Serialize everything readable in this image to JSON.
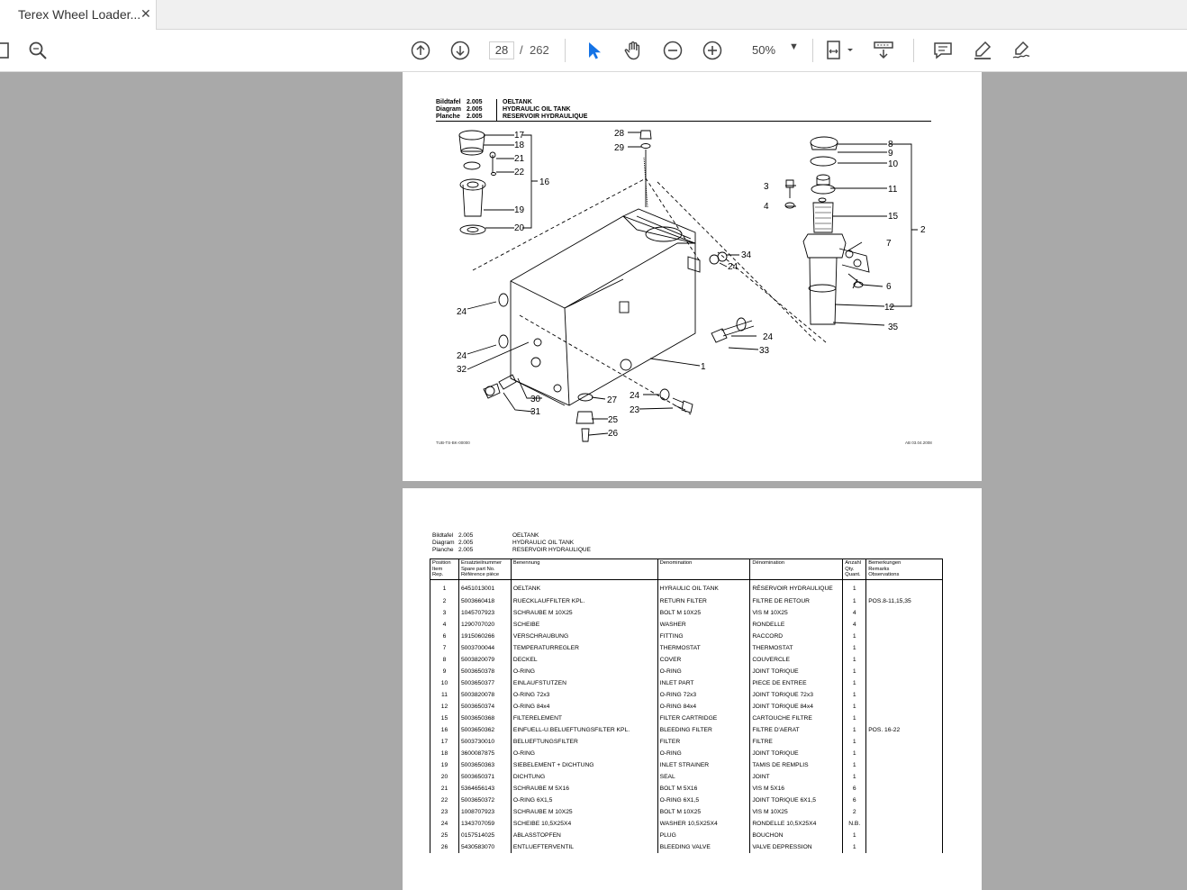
{
  "tab": {
    "title": "Terex Wheel Loader...",
    "close": "✕"
  },
  "toolbar": {
    "page_current": "28",
    "page_separator": "/",
    "page_total": "262",
    "zoom": "50%",
    "icons": [
      "sidebar-icon",
      "search-icon",
      "page-up-icon",
      "page-down-icon",
      "select-cursor-icon",
      "hand-icon",
      "zoom-out-icon",
      "zoom-in-icon",
      "fit-page-icon",
      "scroll-mode-icon",
      "comment-icon",
      "highlight-icon",
      "sign-icon"
    ]
  },
  "page1": {
    "header": {
      "rows": [
        {
          "label": "Bildtafel",
          "num": "2.005",
          "text": "OELTANK"
        },
        {
          "label": "Diagram",
          "num": "2.005",
          "text": "HYDRAULIC OIL TANK"
        },
        {
          "label": "Planche",
          "num": "2.005",
          "text": "RESERVOIR HYDRAULIQUE"
        }
      ]
    },
    "footer_left": "TUB-TS-BK-00000",
    "footer_right": "AB 03.04.2008",
    "callouts": [
      "17",
      "18",
      "21",
      "22",
      "16",
      "19",
      "20",
      "28",
      "29",
      "8",
      "9",
      "10",
      "3",
      "11",
      "4",
      "15",
      "2",
      "7",
      "34",
      "24",
      "6",
      "12",
      "35",
      "24",
      "24",
      "32",
      "1",
      "24",
      "33",
      "30",
      "27",
      "31",
      "24",
      "23",
      "25",
      "26"
    ]
  },
  "page2": {
    "header": {
      "rows": [
        {
          "label": "Bildtafel",
          "num": "2.005",
          "text": "OELTANK"
        },
        {
          "label": "Diagram",
          "num": "2.005",
          "text": "HYDRAULIC OIL TANK"
        },
        {
          "label": "Planche",
          "num": "2.005",
          "text": "RESERVOIR HYDRAULIQUE"
        }
      ]
    },
    "columns": [
      "Position\nItem\nRep.",
      "Ersatzteilnummer\nSpare part No.\nRéférence pièce",
      "Benennung",
      "Denomination",
      "Dénomination",
      "Anzahl\nQty.\nQuant.",
      "Bemerkungen\nRemarks\nObservations"
    ],
    "rows": [
      [
        "1",
        "6451013001",
        "OELTANK",
        "HYRAULIC OIL TANK",
        "RÉSERVOIR HYDRAULIQUE",
        "1",
        ""
      ],
      [
        "2",
        "5003660418",
        "RUECKLAUFFILTER KPL.",
        "RETURN FILTER",
        "FILTRE DE RETOUR",
        "1",
        "POS.8-11,15,35"
      ],
      [
        "3",
        "1045707923",
        "SCHRAUBE M 10X25",
        "BOLT M 10X25",
        "VIS M 10X25",
        "4",
        ""
      ],
      [
        "4",
        "1290707020",
        "SCHEIBE",
        "WASHER",
        "RONDELLE",
        "4",
        ""
      ],
      [
        "6",
        "1915060266",
        "VERSCHRAUBUNG",
        "FITTING",
        "RACCORD",
        "1",
        ""
      ],
      [
        "7",
        "5003700044",
        "TEMPERATURREGLER",
        "THERMOSTAT",
        "THERMOSTAT",
        "1",
        ""
      ],
      [
        "8",
        "5003820079",
        "DECKEL",
        "COVER",
        "COUVERCLE",
        "1",
        ""
      ],
      [
        "9",
        "5003650378",
        "O-RING",
        "O-RING",
        "JOINT TORIQUE",
        "1",
        ""
      ],
      [
        "10",
        "5003650377",
        "EINLAUFSTUTZEN",
        "INLET PART",
        "PIECE DE ENTREE",
        "1",
        ""
      ],
      [
        "11",
        "5003820078",
        "O-RING 72x3",
        "O-RING 72x3",
        "JOINT TORIQUE 72x3",
        "1",
        ""
      ],
      [
        "12",
        "5003650374",
        "O-RING 84x4",
        "O-RING 84x4",
        "JOINT TORIQUE 84x4",
        "1",
        ""
      ],
      [
        "15",
        "5003650368",
        "FILTERELEMENT",
        "FILTER CARTRIDGE",
        "CARTOUCHE FILTRE",
        "1",
        ""
      ],
      [
        "16",
        "5003650362",
        "EINFUELL-U.BELUEFTUNGSFILTER KPL.",
        "BLEEDING FILTER",
        "FILTRE D'AERAT",
        "1",
        "POS. 16-22"
      ],
      [
        "17",
        "5003730010",
        "BELUEFTUNGSFILTER",
        "FILTER",
        "FILTRE",
        "1",
        ""
      ],
      [
        "18",
        "3600087875",
        "O-RING",
        "O-RING",
        "JOINT TORIQUE",
        "1",
        ""
      ],
      [
        "19",
        "5003650363",
        "SIEBELEMENT + DICHTUNG",
        "INLET STRAINER",
        "TAMIS DE REMPLIS",
        "1",
        ""
      ],
      [
        "20",
        "5003650371",
        "DICHTUNG",
        "SEAL",
        "JOINT",
        "1",
        ""
      ],
      [
        "21",
        "5364656143",
        "SCHRAUBE M 5X16",
        "BOLT M 5X16",
        "VIS M 5X16",
        "6",
        ""
      ],
      [
        "22",
        "5003650372",
        "O-RING 6X1,5",
        "O-RING 6X1,5",
        "JOINT TORIQUE 6X1,5",
        "6",
        ""
      ],
      [
        "23",
        "1008707923",
        "SCHRAUBE M 10X25",
        "BOLT M 10X25",
        "VIS M 10X25",
        "2",
        ""
      ],
      [
        "24",
        "1343707059",
        "SCHEIBE 10,5X25X4",
        "WASHER 10,5X25X4",
        "RONDELLE 10,5X25X4",
        "N.B.",
        ""
      ],
      [
        "25",
        "0157514025",
        "ABLASSTOPFEN",
        "PLUG",
        "BOUCHON",
        "1",
        ""
      ],
      [
        "26",
        "5430583070",
        "ENTLUEFTERVENTIL",
        "BLEEDING VALVE",
        "VALVE DEPRESSION",
        "1",
        ""
      ]
    ]
  }
}
